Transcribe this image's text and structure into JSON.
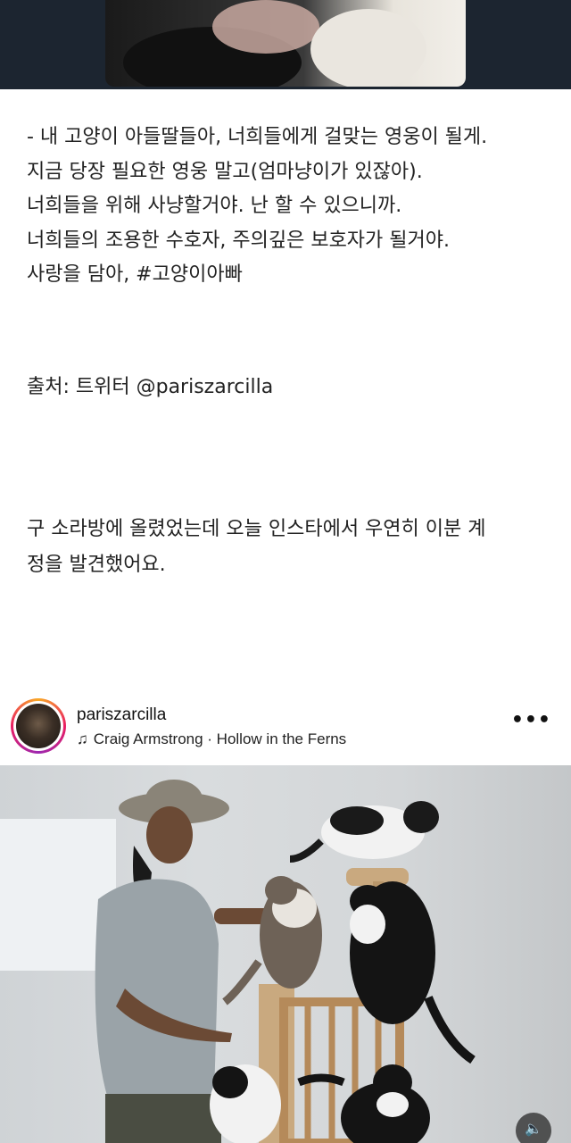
{
  "post_text": {
    "lines": [
      "- 내 고양이 아들딸들아, 너희들에게 걸맞는 영웅이 될게.",
      "지금 당장 필요한 영웅 말고(엄마냥이가 있잖아).",
      "너희들을 위해 사냥할거야. 난 할 수 있으니까.",
      "너희들의 조용한 수호자, 주의깊은 보호자가 될거야.",
      "사랑을 담아, #고양이아빠"
    ],
    "source": "출처: 트위터 @pariszarcilla",
    "paragraph2_line1": "구 소라방에 올렸었는데 오늘 인스타에서 우연히 이분 계",
    "paragraph2_line2": "정을 발견했어요."
  },
  "instagram": {
    "username": "pariszarcilla",
    "music_icon": "music-note-icon",
    "music": "Craig Armstrong · Hollow in the Ferns",
    "more_icon": "more-horizontal-icon",
    "mute_icon": "speaker-icon"
  },
  "colors": {
    "top_strip": "#1c2530",
    "text": "#222222",
    "background": "#ffffff"
  }
}
